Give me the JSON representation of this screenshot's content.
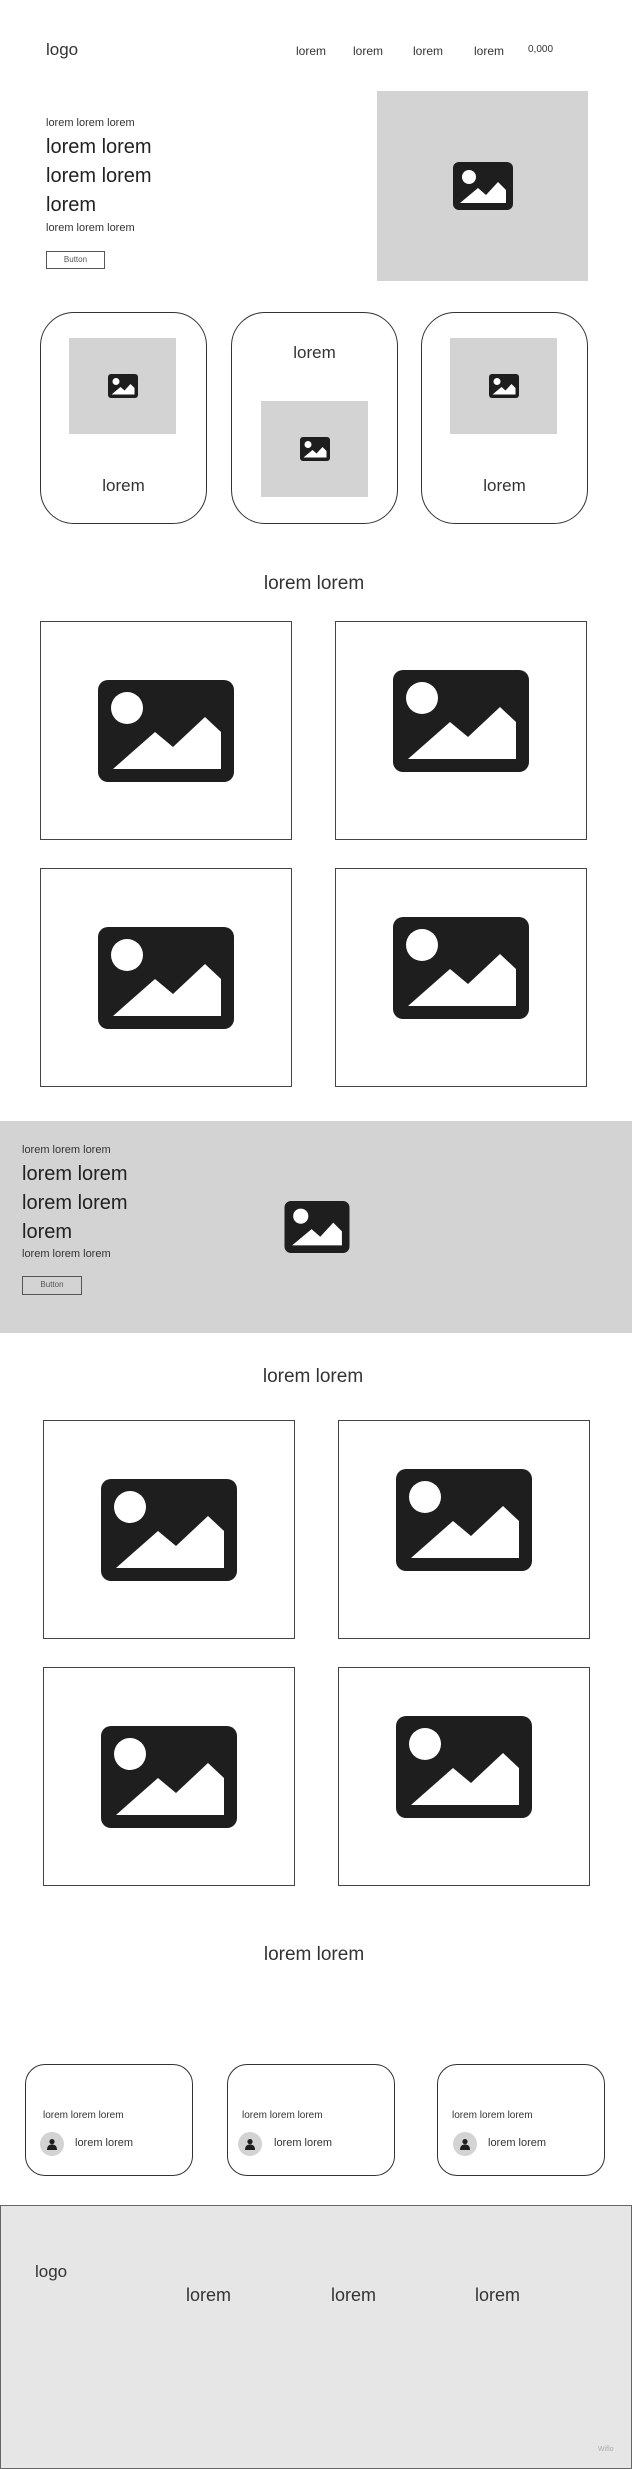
{
  "header": {
    "logo": "logo",
    "nav": [
      "lorem",
      "lorem",
      "lorem",
      "lorem"
    ],
    "cart": "0,000"
  },
  "hero": {
    "eyebrow": "lorem lorem lorem",
    "title_lines": [
      "lorem lorem",
      "lorem lorem",
      "lorem"
    ],
    "subtitle": "lorem lorem lorem",
    "button": "Button",
    "image_icon": "image-icon"
  },
  "feature_cards": [
    {
      "label": "lorem",
      "icon": "image-icon"
    },
    {
      "label": "lorem",
      "icon": "image-icon"
    },
    {
      "label": "lorem",
      "icon": "image-icon"
    }
  ],
  "gallery1": {
    "title": "lorem lorem"
  },
  "banner": {
    "eyebrow": "lorem lorem lorem",
    "title_lines": [
      "lorem lorem",
      "lorem lorem",
      "lorem"
    ],
    "subtitle": "lorem lorem lorem",
    "button": "Button"
  },
  "gallery2": {
    "title": "lorem lorem"
  },
  "testimonials": {
    "title": "lorem lorem",
    "cards": [
      {
        "text": "lorem lorem lorem",
        "name": "lorem lorem"
      },
      {
        "text": "lorem lorem lorem",
        "name": "lorem lorem"
      },
      {
        "text": "lorem lorem lorem",
        "name": "lorem lorem"
      }
    ]
  },
  "footer": {
    "logo": "logo",
    "links": [
      "lorem",
      "lorem",
      "lorem"
    ],
    "badge": "Wiflo"
  },
  "colors": {
    "placeholder": "#d3d3d3",
    "banner_bg": "#d3d3d3",
    "footer_bg": "#e6e6e6",
    "icon": "#1e1e1e"
  }
}
